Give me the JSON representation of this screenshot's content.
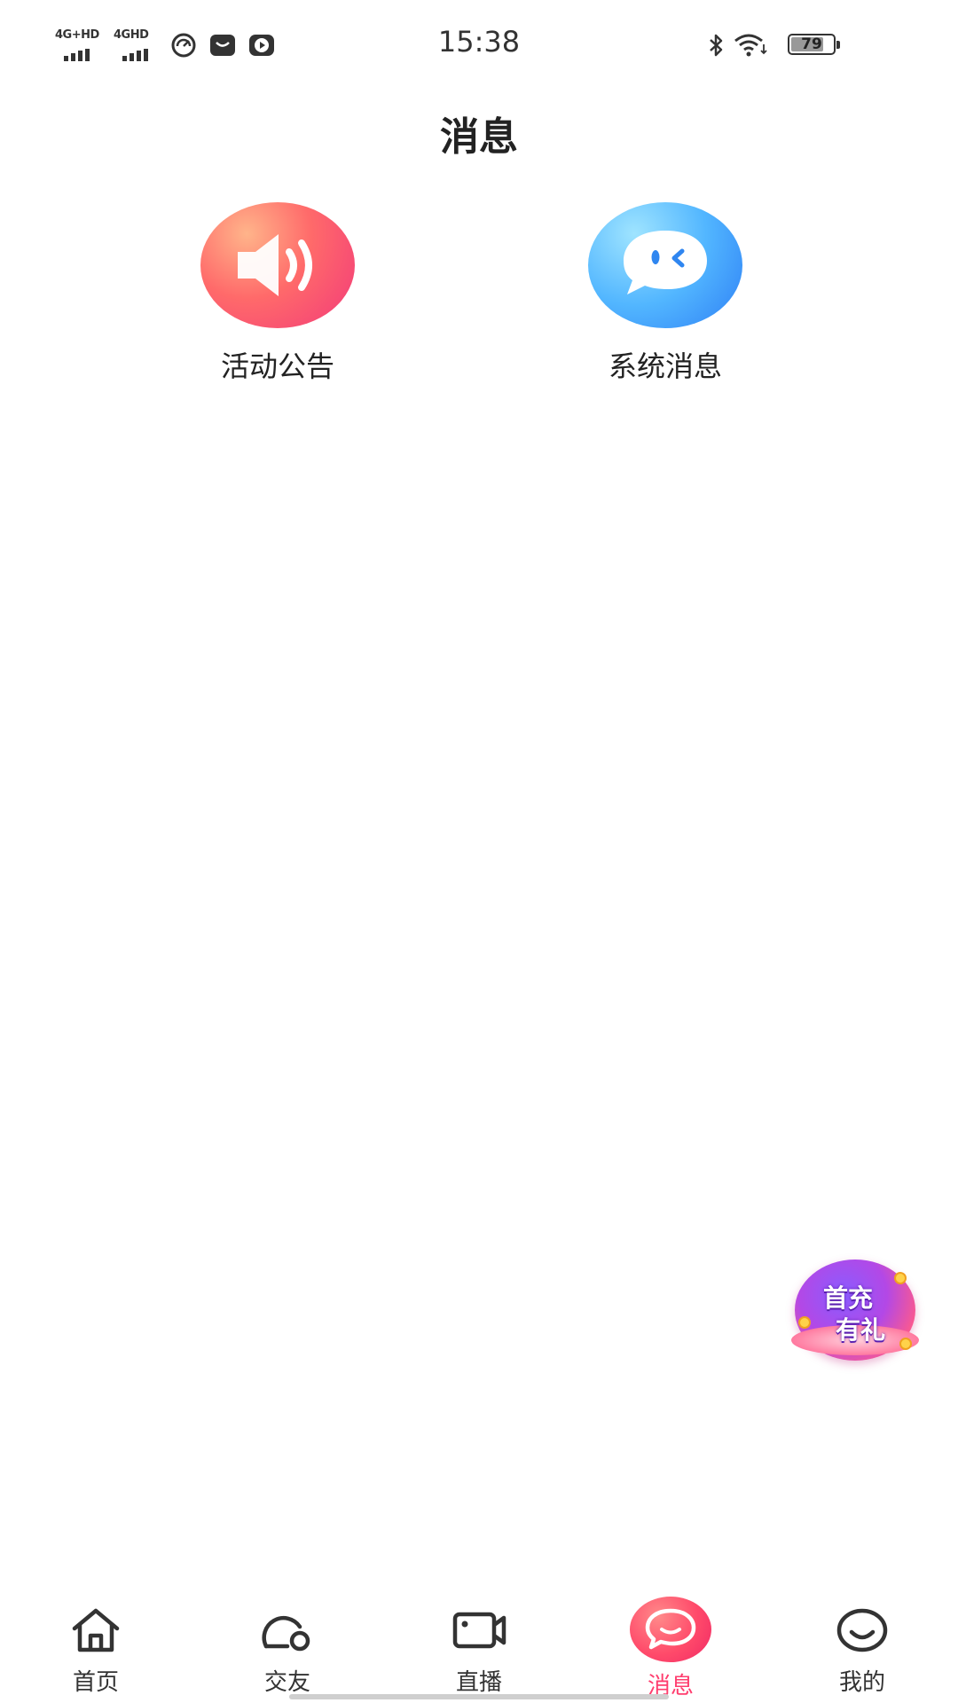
{
  "status_bar": {
    "sim1": "4G+HD",
    "sim2": "4GHD",
    "time": "15:38",
    "battery": 79
  },
  "header": {
    "title": "消息"
  },
  "shortcuts": [
    {
      "label": "活动公告",
      "icon": "speaker-icon",
      "color": "#f5466e"
    },
    {
      "label": "系统消息",
      "icon": "chat-bubble-icon",
      "color": "#3f9cf8"
    }
  ],
  "promo": {
    "line1": "首充",
    "line2": "有礼"
  },
  "bottom_nav": {
    "active": 3,
    "active_color": "#ff3d6e",
    "items": [
      {
        "label": "首页",
        "icon": "home-icon"
      },
      {
        "label": "交友",
        "icon": "friends-icon"
      },
      {
        "label": "直播",
        "icon": "video-camera-icon"
      },
      {
        "label": "消息",
        "icon": "message-icon"
      },
      {
        "label": "我的",
        "icon": "smiley-icon"
      }
    ]
  }
}
